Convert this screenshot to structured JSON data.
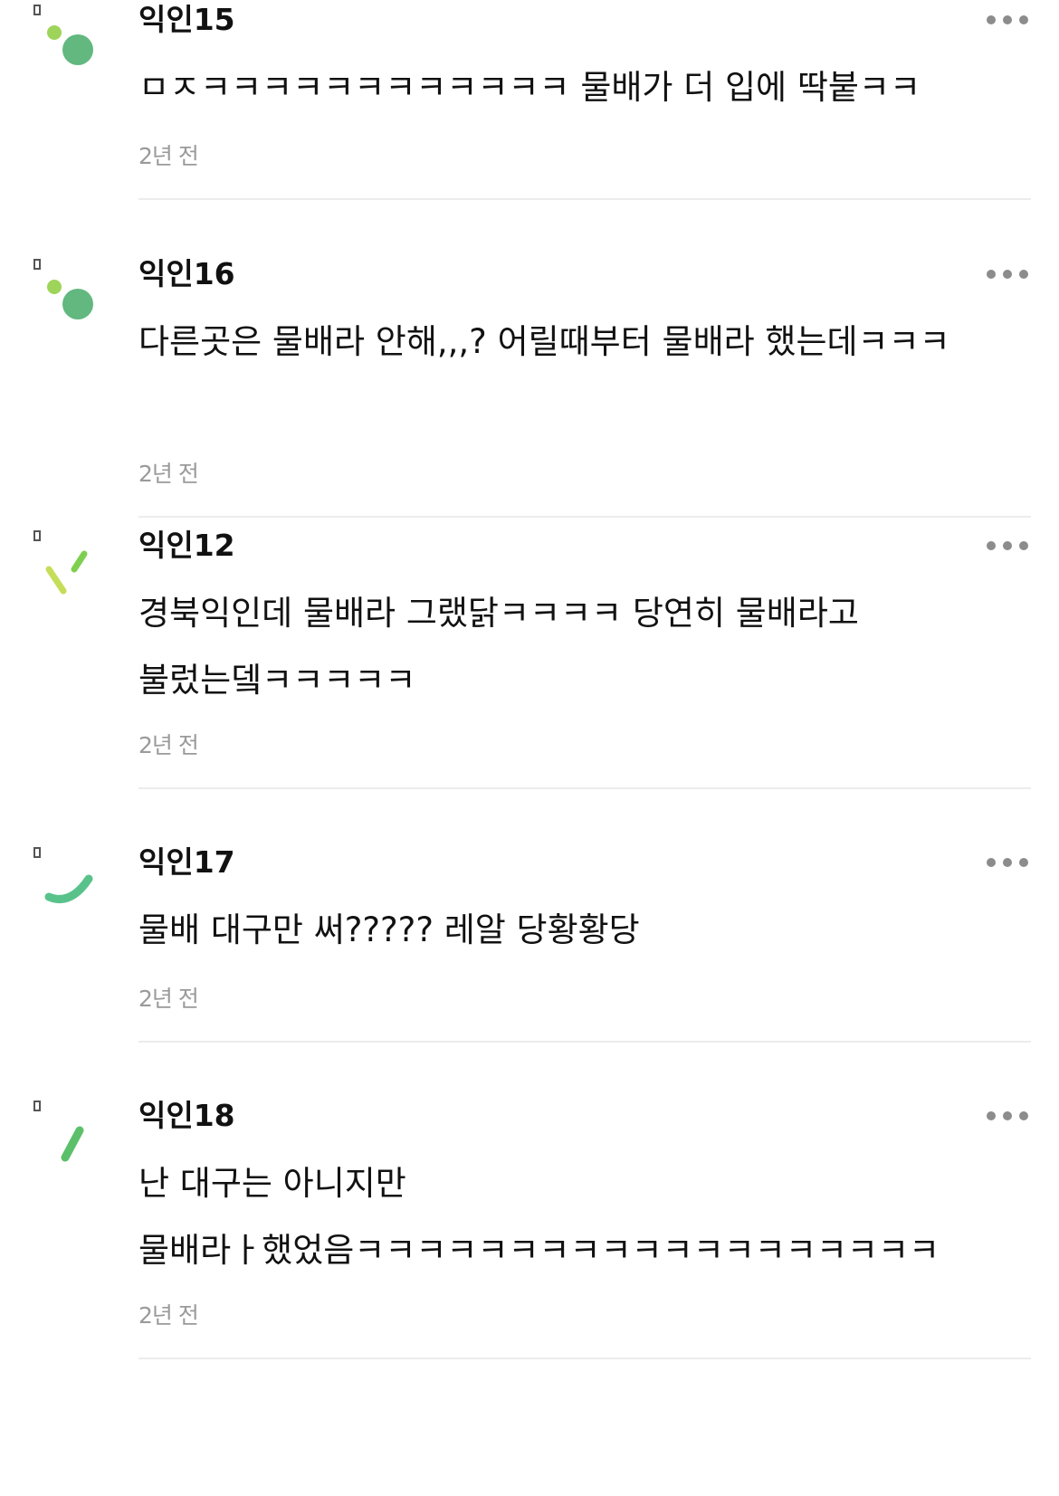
{
  "comments": [
    {
      "author": "익인15",
      "text": "ㅁㅈㅋㅋㅋㅋㅋㅋㅋㅋㅋㅋㅋㅋ 물배가 더 입에 딱붙ㅋㅋ",
      "time": "2년 전",
      "avatar_icon": "dots-avatar-icon"
    },
    {
      "author": "익인16",
      "text": "다른곳은 물배라 안해,,,? 어릴때부터 물배라 했는데ㅋㅋㅋ",
      "time": "2년 전",
      "avatar_icon": "dots-avatar-icon"
    },
    {
      "author": "익인12",
      "text": "경북익인데 물배라 그랬닭ㅋㅋㅋㅋ 당연히 물배라고 불렀는뎈ㅋㅋㅋㅋㅋ",
      "time": "2년 전",
      "avatar_icon": "dashes-avatar-icon"
    },
    {
      "author": "익인17",
      "text": "물배 대구만 써????? 레알 당황황당",
      "time": "2년 전",
      "avatar_icon": "arc-avatar-icon"
    },
    {
      "author": "익인18",
      "text": "난 대구는 아니지만 물배라ㅏ했었음ㅋㅋㅋㅋㅋㅋㅋㅋㅋㅋㅋㅋㅋㅋㅋㅋㅋㅋㅋ",
      "time": "2년 전",
      "avatar_icon": "slash-avatar-icon"
    }
  ],
  "colors": {
    "avatar_light_green": "#9fd45a",
    "avatar_green": "#62b87f",
    "avatar_arc_green": "#59c28a",
    "avatar_yellow_green": "#c4de5a",
    "divider": "#ececec",
    "time": "#9a9a9a",
    "more_dots": "#8c8c8c"
  }
}
